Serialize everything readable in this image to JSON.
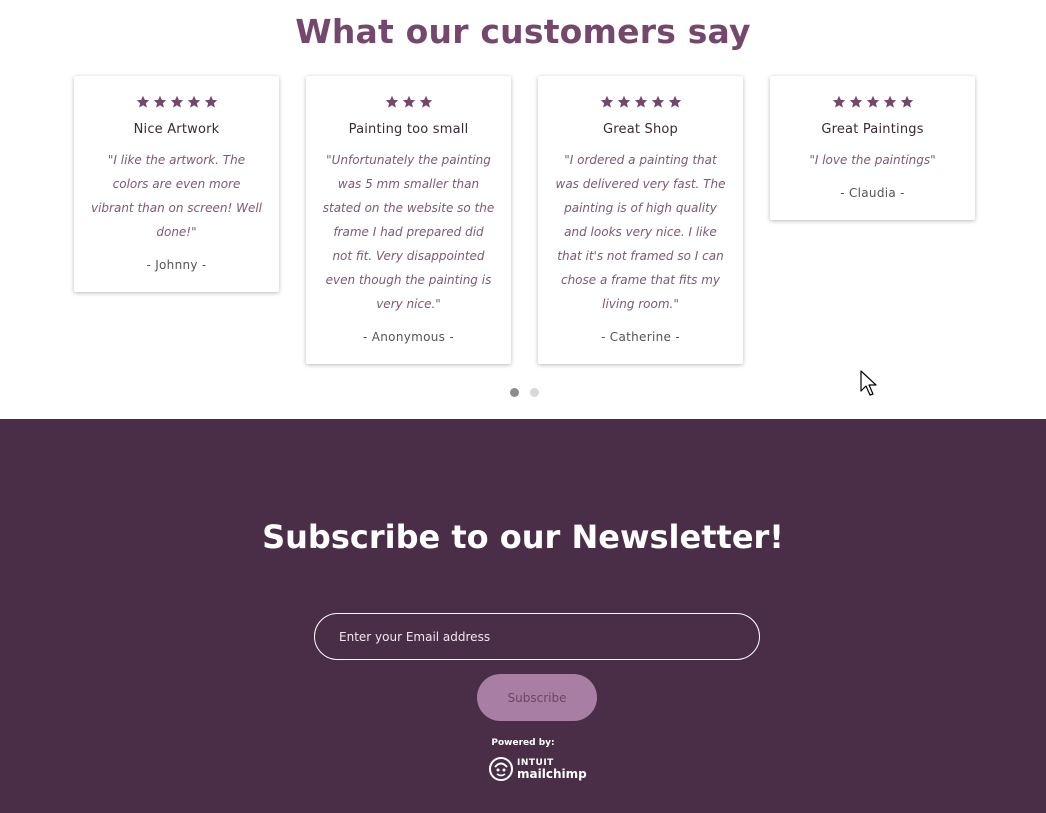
{
  "reviews": {
    "title": "What our customers say",
    "star_color": "#74486c",
    "cards": [
      {
        "stars": 5,
        "title": "Nice Artwork",
        "quote": "\"I like the artwork. The colors are even more vibrant than on screen! Well done!\"",
        "author": "- Johnny -"
      },
      {
        "stars": 3,
        "title": "Painting too small",
        "quote": "\"Unfortunately the painting was 5 mm smaller than stated on the website so the frame I had prepared did not fit. Very disappointed even though the painting is very nice.\"",
        "author": "- Anonymous -"
      },
      {
        "stars": 5,
        "title": "Great Shop",
        "quote": "\"I ordered a painting that was delivered very fast. The painting is of high quality and looks very nice. I like that it's not framed so I can chose a frame that fits my living room.\"",
        "author": "- Catherine -"
      },
      {
        "stars": 5,
        "title": "Great Paintings",
        "quote": "\"I love the paintings\"",
        "author": "- Claudia -"
      }
    ],
    "carousel": {
      "pages": 2,
      "active_page": 1
    }
  },
  "newsletter": {
    "title": "Subscribe to our Newsletter!",
    "email_placeholder": "Enter your Email address",
    "subscribe_label": "Subscribe",
    "powered_by": "Powered by:",
    "logo_intuit": "INTUIT",
    "logo_name": "mailchimp",
    "background_color": "#4a2e48",
    "button_color": "#a97ea4"
  }
}
